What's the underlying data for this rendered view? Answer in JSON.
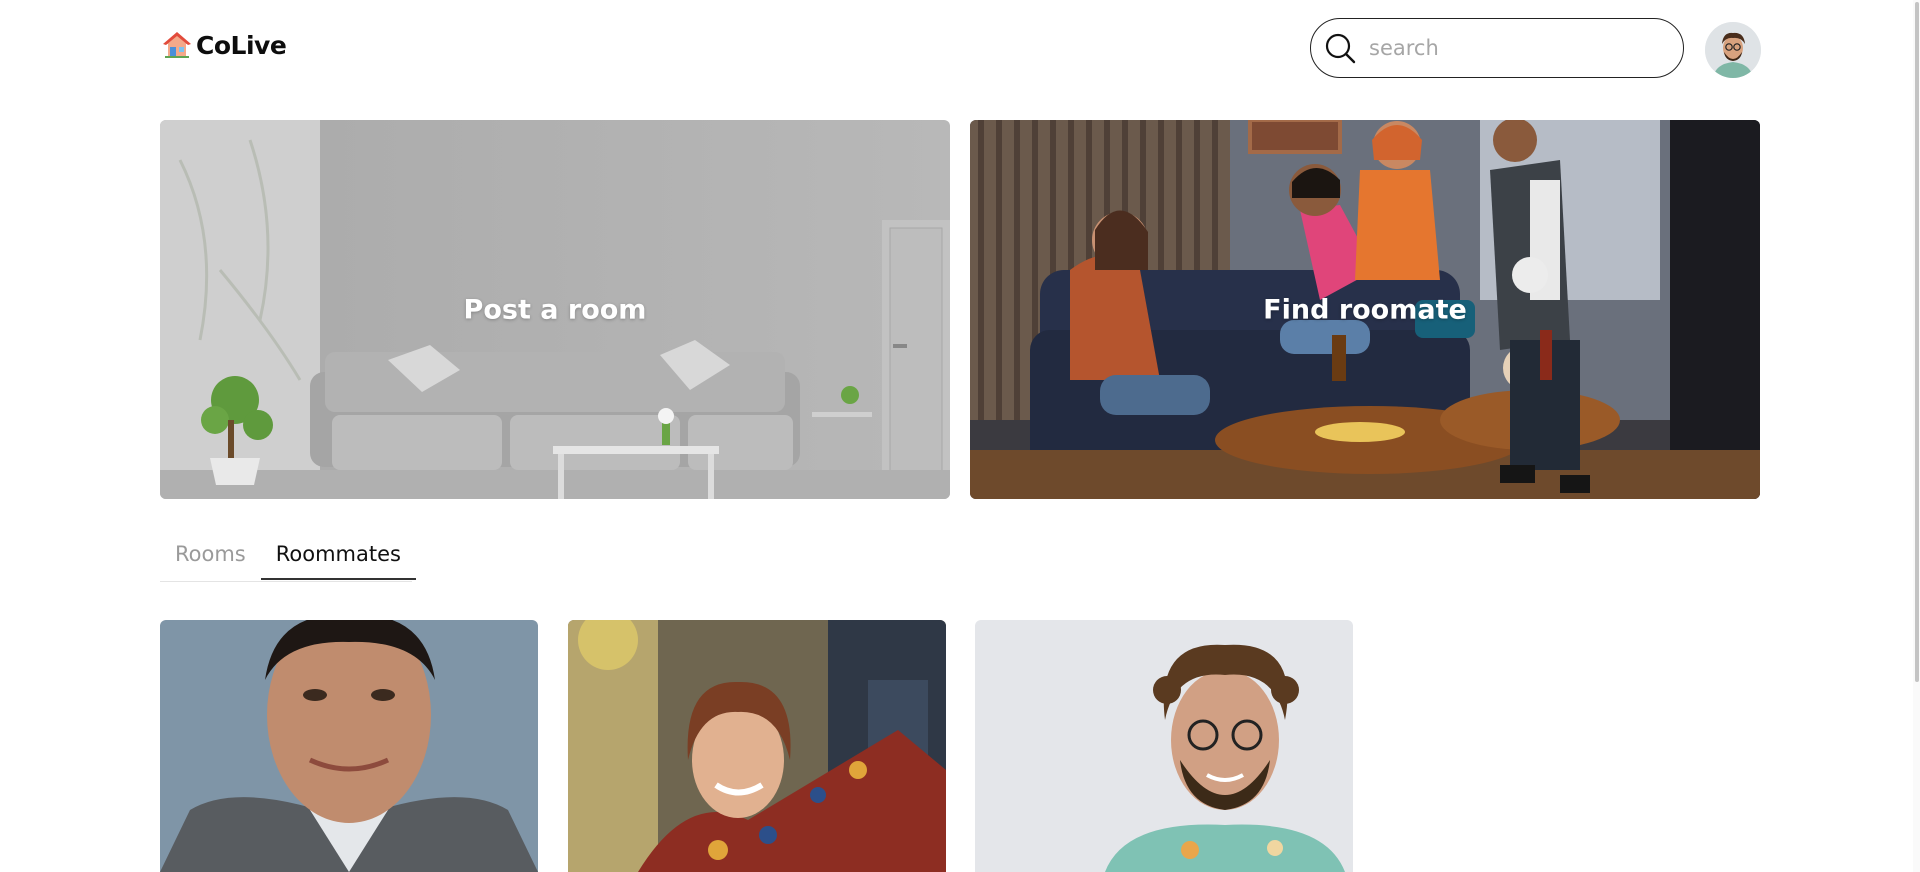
{
  "app": {
    "name": "CoLive",
    "logo_icon": "house-icon"
  },
  "search": {
    "placeholder": "search",
    "value": "",
    "icon": "search-icon"
  },
  "user": {
    "avatar": "user-avatar"
  },
  "hero": {
    "post_label": "Post a room",
    "find_label": "Find roomate"
  },
  "tabs": [
    {
      "label": "Rooms",
      "active": false
    },
    {
      "label": "Roommates",
      "active": true
    }
  ],
  "colors": {
    "accent": "#333333",
    "muted_text": "#9a9a9a",
    "border": "#222222"
  }
}
